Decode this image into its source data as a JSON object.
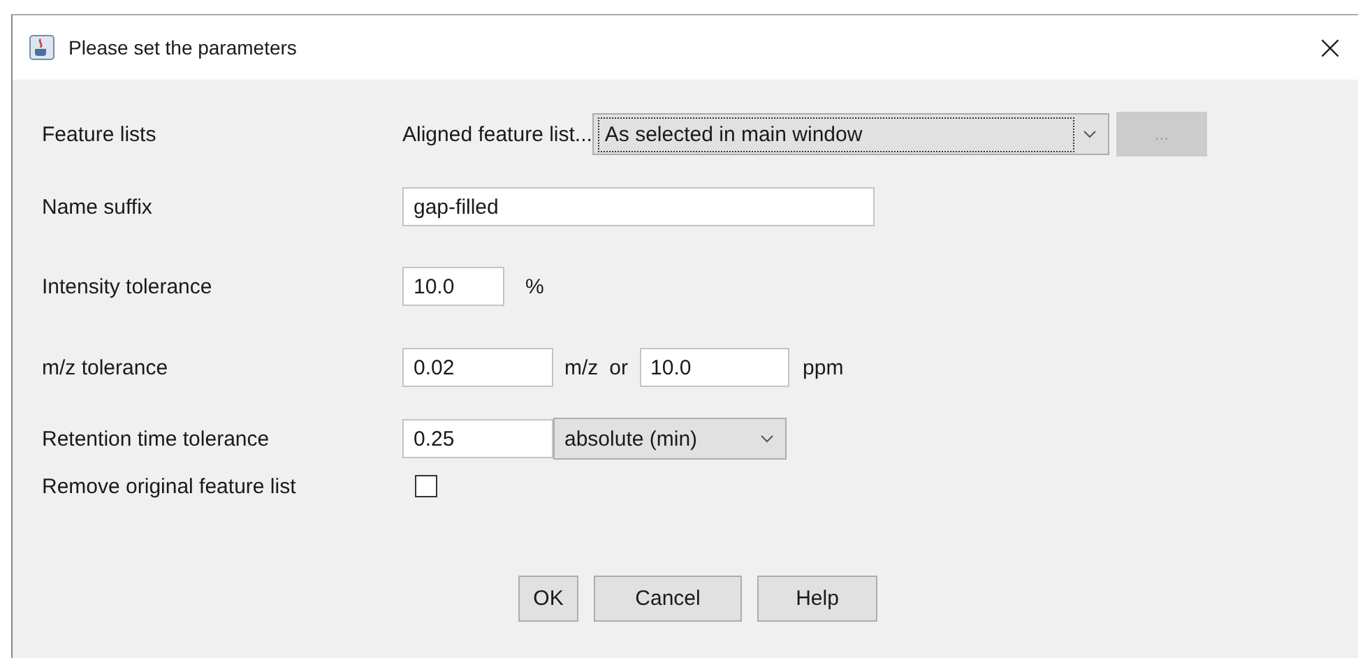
{
  "window": {
    "title": "Please set the parameters",
    "close": "×"
  },
  "rows": [
    {
      "kind": "combo",
      "label": "Feature lists",
      "prefix": "Aligned feature list...",
      "value": "As selected in main window",
      "extra_button": {
        "label": "...",
        "disabled": true
      }
    },
    {
      "kind": "text",
      "label": "Name suffix",
      "value": "gap-filled"
    },
    {
      "kind": "unit",
      "label": "Intensity tolerance",
      "value": "10.0",
      "unit": "%"
    },
    {
      "kind": "double",
      "label": "m/z tolerance",
      "value": "0.02",
      "unit": "m/z",
      "joiner": "or",
      "value2": "10.0",
      "unit2": "ppm"
    },
    {
      "kind": "select",
      "label": "Retention time tolerance",
      "value": "0.25",
      "option": "absolute (min)"
    },
    {
      "kind": "check",
      "label": "Remove original feature list",
      "checked": false
    }
  ],
  "buttons": [
    "OK",
    "Cancel",
    "Help"
  ]
}
